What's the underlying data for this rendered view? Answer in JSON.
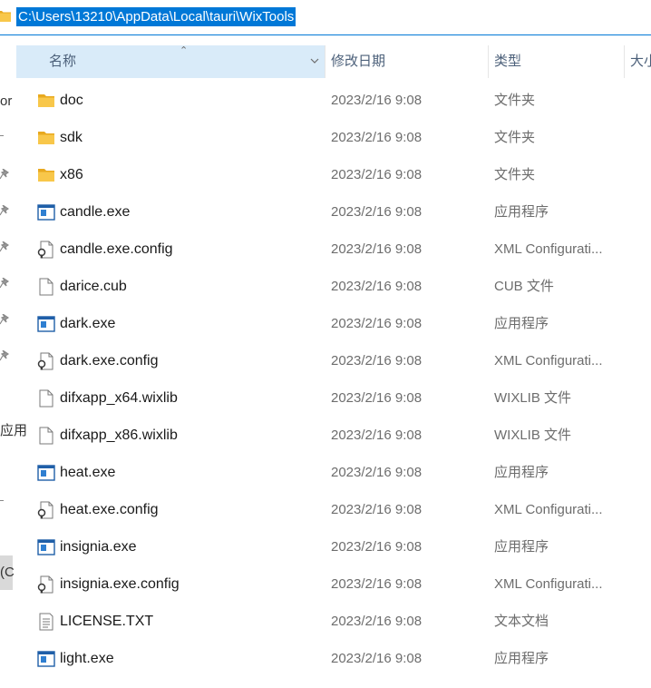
{
  "address_bar": {
    "path": "C:\\Users\\13210\\AppData\\Local\\tauri\\WixTools"
  },
  "nav_fragments": {
    "frag_top": "or",
    "frag_mid": "应用",
    "frag_bottom": "(C"
  },
  "columns": {
    "name": "名称",
    "date_modified": "修改日期",
    "type": "类型",
    "size": "大小"
  },
  "files": [
    {
      "name": "doc",
      "date": "2023/2/16 9:08",
      "type": "文件夹",
      "icon": "folder-icon"
    },
    {
      "name": "sdk",
      "date": "2023/2/16 9:08",
      "type": "文件夹",
      "icon": "folder-icon"
    },
    {
      "name": "x86",
      "date": "2023/2/16 9:08",
      "type": "文件夹",
      "icon": "folder-icon"
    },
    {
      "name": "candle.exe",
      "date": "2023/2/16 9:08",
      "type": "应用程序",
      "icon": "exe-icon"
    },
    {
      "name": "candle.exe.config",
      "date": "2023/2/16 9:08",
      "type": "XML Configurati...",
      "icon": "config-file-icon"
    },
    {
      "name": "darice.cub",
      "date": "2023/2/16 9:08",
      "type": "CUB 文件",
      "icon": "blank-file-icon"
    },
    {
      "name": "dark.exe",
      "date": "2023/2/16 9:08",
      "type": "应用程序",
      "icon": "exe-icon"
    },
    {
      "name": "dark.exe.config",
      "date": "2023/2/16 9:08",
      "type": "XML Configurati...",
      "icon": "config-file-icon"
    },
    {
      "name": "difxapp_x64.wixlib",
      "date": "2023/2/16 9:08",
      "type": "WIXLIB 文件",
      "icon": "blank-file-icon"
    },
    {
      "name": "difxapp_x86.wixlib",
      "date": "2023/2/16 9:08",
      "type": "WIXLIB 文件",
      "icon": "blank-file-icon"
    },
    {
      "name": "heat.exe",
      "date": "2023/2/16 9:08",
      "type": "应用程序",
      "icon": "exe-icon"
    },
    {
      "name": "heat.exe.config",
      "date": "2023/2/16 9:08",
      "type": "XML Configurati...",
      "icon": "config-file-icon"
    },
    {
      "name": "insignia.exe",
      "date": "2023/2/16 9:08",
      "type": "应用程序",
      "icon": "exe-icon"
    },
    {
      "name": "insignia.exe.config",
      "date": "2023/2/16 9:08",
      "type": "XML Configurati...",
      "icon": "config-file-icon"
    },
    {
      "name": "LICENSE.TXT",
      "date": "2023/2/16 9:08",
      "type": "文本文档",
      "icon": "text-file-icon"
    },
    {
      "name": "light.exe",
      "date": "2023/2/16 9:08",
      "type": "应用程序",
      "icon": "exe-icon"
    }
  ],
  "colors": {
    "selection_blue": "#0078d7",
    "header_hover": "#d9ebf9",
    "folder_yellow": "#f8c74a",
    "exe_blue": "#1f5fa8"
  }
}
